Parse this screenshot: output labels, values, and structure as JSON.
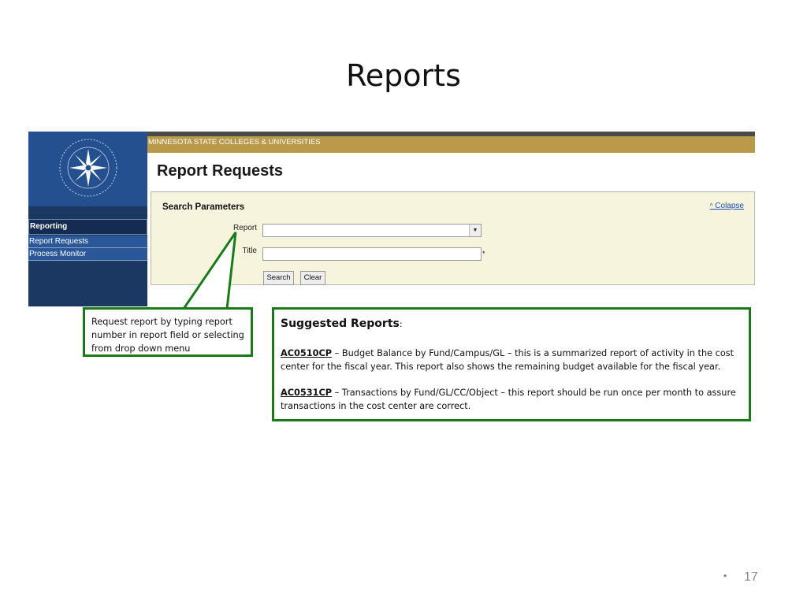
{
  "slide": {
    "title": "Reports",
    "page_number": "17"
  },
  "screenshot": {
    "brand_bar": "MINNESOTA STATE COLLEGES & UNIVERSITIES",
    "nav": {
      "heading": "Reporting",
      "items": [
        {
          "label": "Report Requests"
        },
        {
          "label": "Process Monitor"
        }
      ]
    },
    "page_heading": "Report Requests",
    "search_panel": {
      "heading": "Search Parameters",
      "collapse_label": "Colapse",
      "report_label": "Report",
      "report_value": "",
      "title_label": "Title",
      "title_value": "",
      "required_marker": "*",
      "search_button": "Search",
      "clear_button": "Clear"
    }
  },
  "callouts": {
    "left_text": "Request report by typing report number in report field or selecting from drop down menu",
    "right": {
      "heading": "Suggested Reports",
      "heading_suffix": ":",
      "report1_code": "AC0510CP",
      "report1_text": " – Budget Balance by Fund/Campus/GL – this is a summarized report of activity in the cost center for the fiscal year.  This report also shows the remaining budget available for the fiscal year.",
      "report2_code": "AC0531CP",
      "report2_text": " – Transactions by Fund/GL/CC/Object – this report should be run once per month to assure transactions in the cost center are correct."
    }
  },
  "colors": {
    "callout_border": "#1a7a1a",
    "nav_bg": "#1b3863",
    "gold_bar": "#b89a4a",
    "panel_bg": "#f6f4dc"
  }
}
